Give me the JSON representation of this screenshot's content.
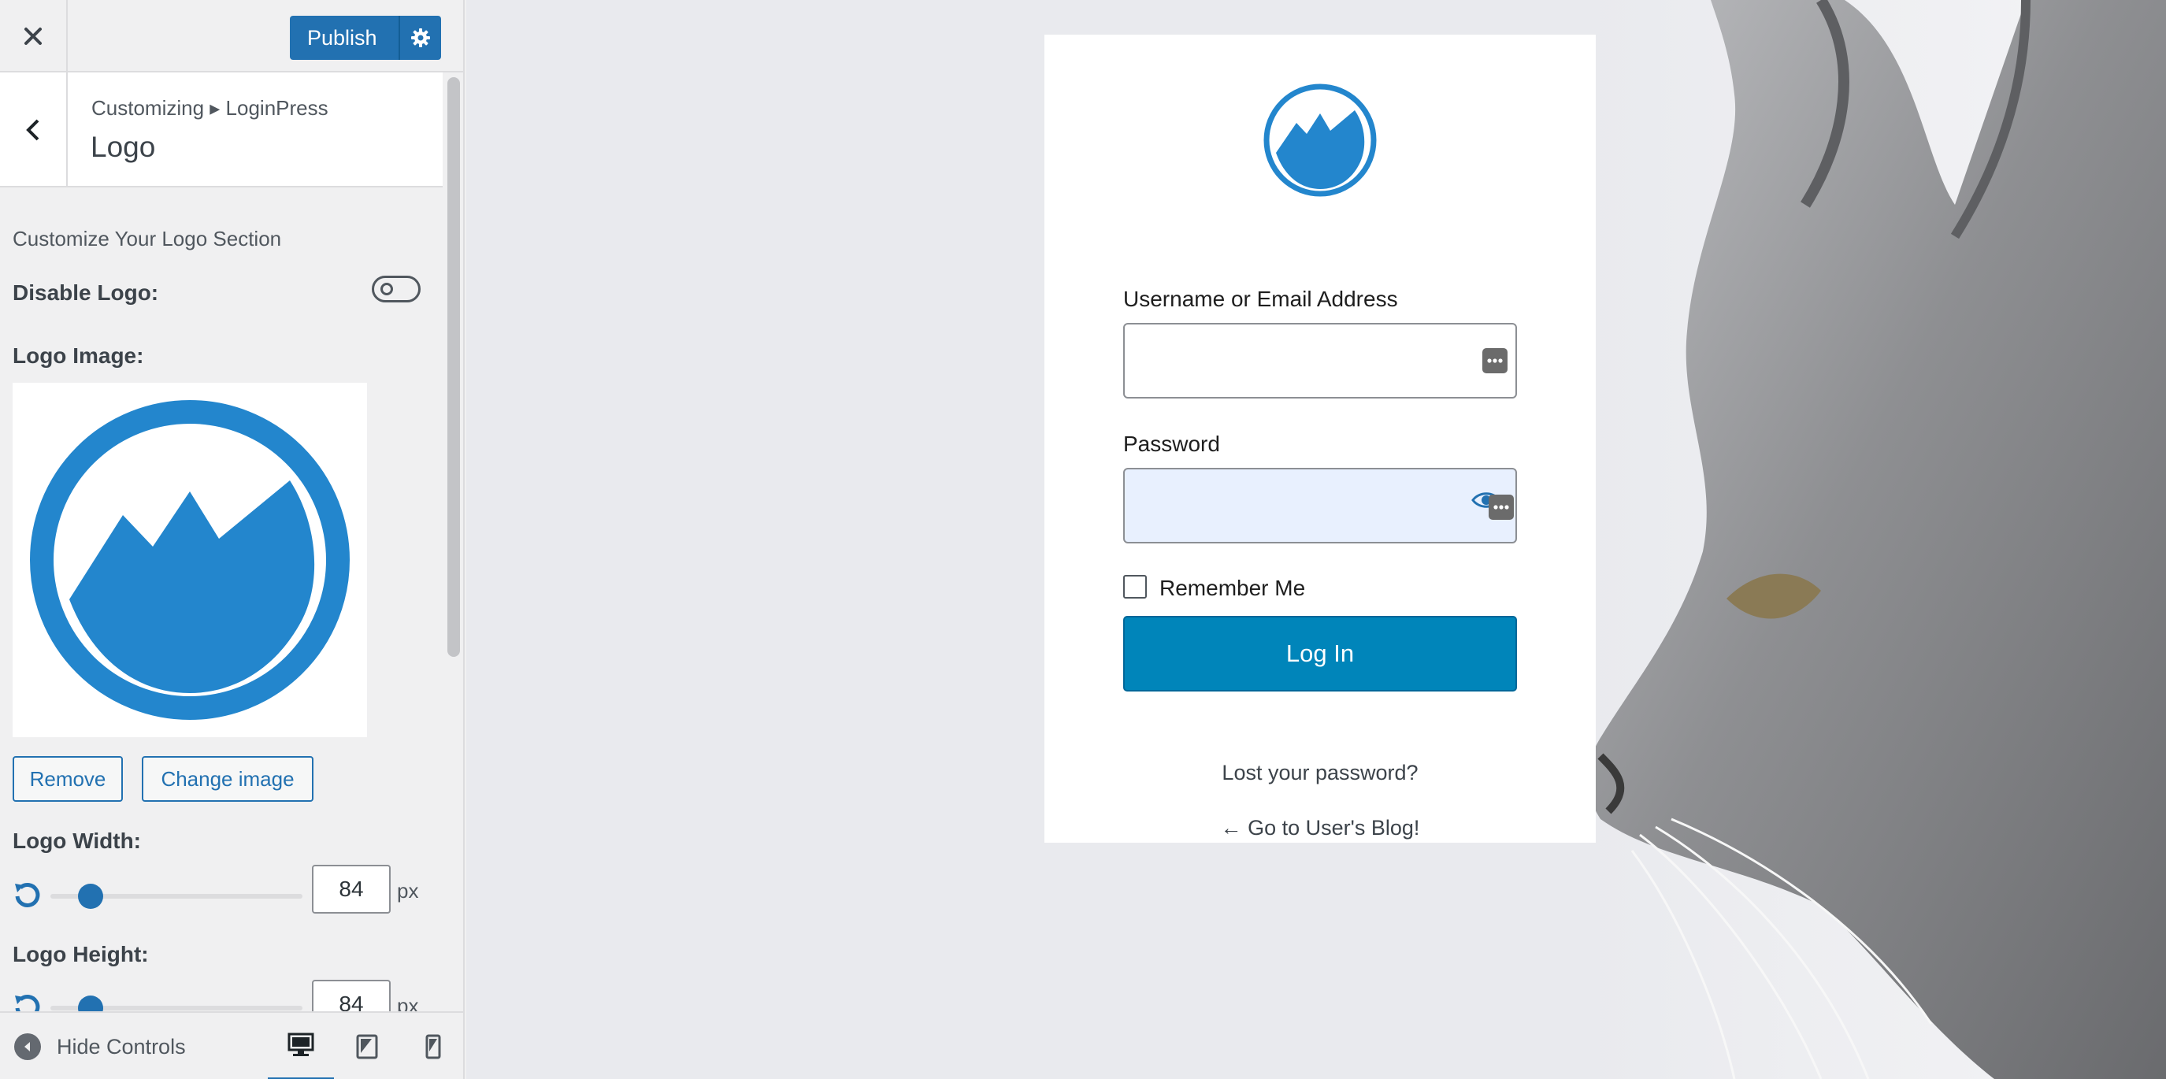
{
  "topbar": {
    "publish_label": "Publish"
  },
  "section": {
    "breadcrumb": "Customizing ▸ LoginPress",
    "title": "Logo",
    "description": "Customize Your Logo Section"
  },
  "controls": {
    "disable_logo_label": "Disable Logo:",
    "disable_logo_on": false,
    "logo_image_label": "Logo Image:",
    "remove_label": "Remove",
    "change_image_label": "Change image",
    "logo_width_label": "Logo Width:",
    "logo_width_value": "84",
    "logo_height_label": "Logo Height:",
    "logo_height_value": "84",
    "unit": "px",
    "slider_fraction": 0.12
  },
  "footer": {
    "hide_controls_label": "Hide Controls"
  },
  "login": {
    "username_label": "Username or Email Address",
    "password_label": "Password",
    "remember_label": "Remember Me",
    "login_button": "Log In",
    "lost_password": "Lost your password?",
    "back_to_blog": "← Go to User's Blog!"
  },
  "colors": {
    "accent": "#2271b1",
    "logo_blue": "#2386cd",
    "login_button": "#0085ba"
  }
}
